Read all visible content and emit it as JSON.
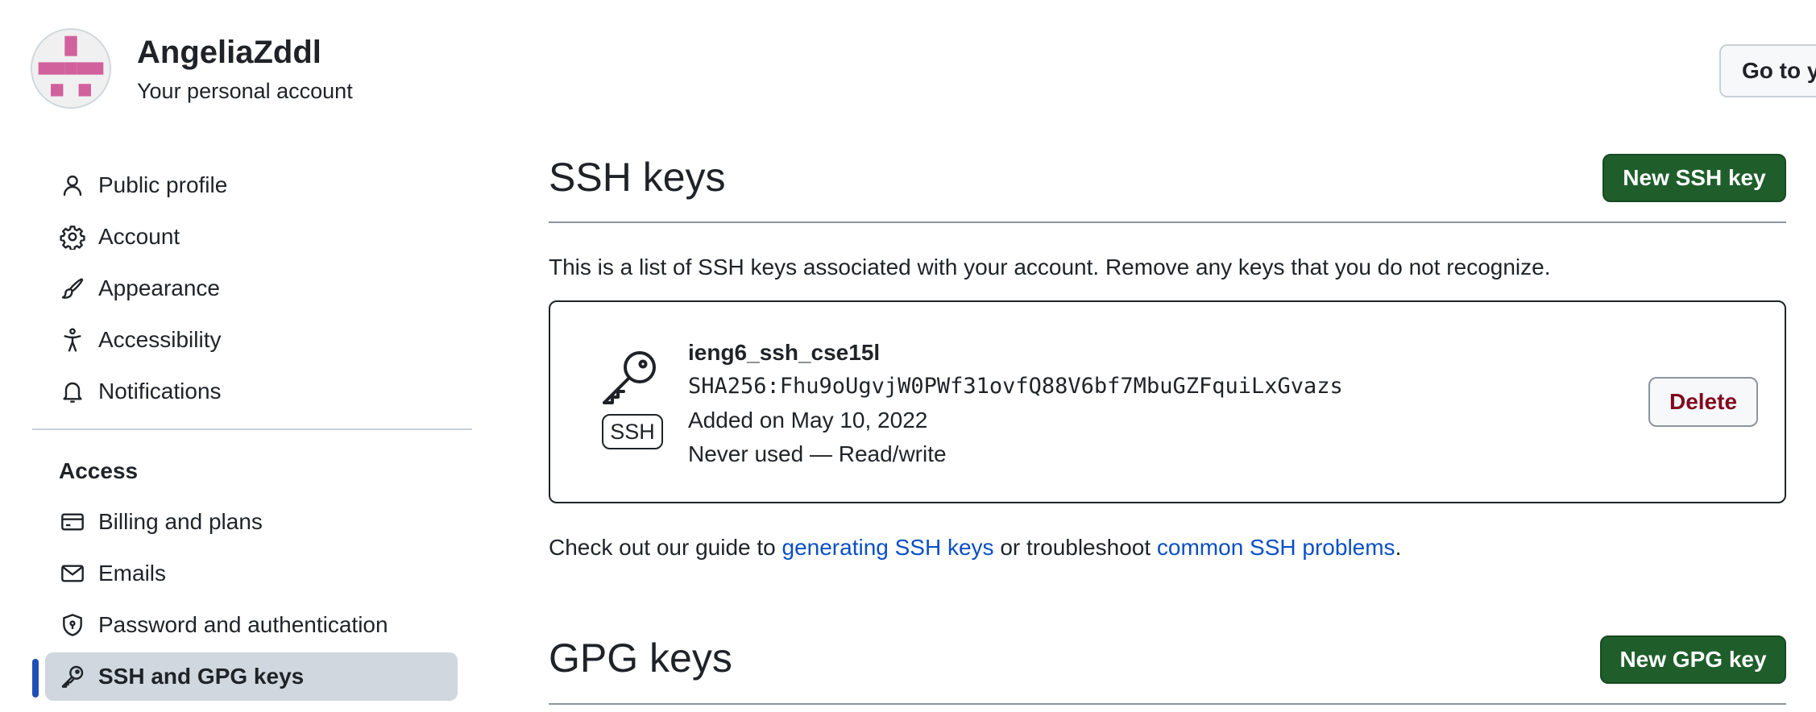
{
  "header": {
    "account_name": "AngeliaZddl",
    "account_subtitle": "Your personal account",
    "goto_button": "Go to y"
  },
  "sidebar": {
    "items": [
      {
        "label": "Public profile",
        "icon": "person-icon"
      },
      {
        "label": "Account",
        "icon": "gear-icon"
      },
      {
        "label": "Appearance",
        "icon": "paintbrush-icon"
      },
      {
        "label": "Accessibility",
        "icon": "accessibility-icon"
      },
      {
        "label": "Notifications",
        "icon": "bell-icon"
      }
    ],
    "access_heading": "Access",
    "access_items": [
      {
        "label": "Billing and plans",
        "icon": "credit-card-icon"
      },
      {
        "label": "Emails",
        "icon": "mail-icon"
      },
      {
        "label": "Password and authentication",
        "icon": "shield-lock-icon"
      },
      {
        "label": "SSH and GPG keys",
        "icon": "key-icon",
        "active": true
      }
    ]
  },
  "ssh": {
    "title": "SSH keys",
    "new_button": "New SSH key",
    "description": "This is a list of SSH keys associated with your account. Remove any keys that you do not recognize.",
    "key": {
      "name": "ieng6_ssh_cse15l",
      "fingerprint": "SHA256:Fhu9oUgvjW0PWf31ovfQ88V6bf7MbuGZFquiLxGvazs",
      "added": "Added on May 10, 2022",
      "usage": "Never used — Read/write",
      "badge": "SSH",
      "delete_label": "Delete"
    },
    "guide": {
      "prefix": "Check out our guide to ",
      "link1": "generating SSH keys",
      "middle": " or troubleshoot ",
      "link2": "common SSH problems",
      "suffix": "."
    }
  },
  "gpg": {
    "title": "GPG keys",
    "new_button": "New GPG key"
  },
  "colors": {
    "primary_button": "#1f5e2b",
    "link": "#0b4fc5",
    "danger_text": "#82071e",
    "active_indicator": "#1f4fb5",
    "avatar_pink": "#d1619d"
  }
}
